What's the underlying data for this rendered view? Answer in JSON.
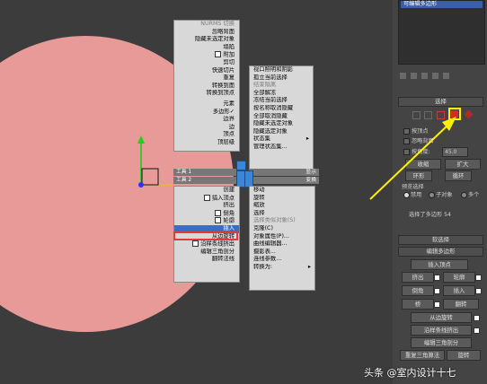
{
  "quad_menu": {
    "left_top": [
      {
        "label": "NURMS 切换",
        "dim": true
      },
      {
        "label": "忽略背面",
        "dim": false
      },
      {
        "label": "隐藏未选定对象",
        "dim": false
      },
      {
        "label": "塌陷",
        "dim": false
      },
      {
        "label": "附加",
        "dim": false,
        "checkbox": true
      },
      {
        "label": "剪切",
        "dim": false
      },
      {
        "label": "快速切片",
        "dim": false
      },
      {
        "label": "重复",
        "dim": false
      },
      {
        "label": "转换到面",
        "dim": false
      },
      {
        "label": "转换到顶点",
        "dim": false
      }
    ],
    "left_mid": [
      {
        "label": "元素",
        "dim": false
      },
      {
        "label": "多边形",
        "dim": false,
        "check": "✓"
      },
      {
        "label": "边界",
        "dim": false
      },
      {
        "label": "边",
        "dim": false
      },
      {
        "label": "顶点",
        "dim": false
      },
      {
        "label": "顶层级",
        "dim": false
      }
    ],
    "left_titles": [
      "工具 1",
      "工具 2"
    ],
    "right_titles": [
      "显示",
      "变换"
    ],
    "right_top": [
      {
        "label": "孤立当前选择",
        "dim": false
      },
      {
        "label": "结束隔离",
        "dim": true
      },
      {
        "label": "全部解冻",
        "dim": false
      },
      {
        "label": "冻结当前选择",
        "dim": false
      },
      {
        "label": "按名称取消隐藏",
        "dim": false
      },
      {
        "label": "全部取消隐藏",
        "dim": false
      },
      {
        "label": "隐藏未选定对象",
        "dim": false
      },
      {
        "label": "隐藏选定对象",
        "dim": false
      },
      {
        "label": "状态集",
        "dim": false,
        "arrow": true
      },
      {
        "label": "管理状态集...",
        "dim": false
      }
    ],
    "right_top_first": "视口照明和阴影",
    "left_bottom": [
      {
        "label": "创建",
        "dim": false
      },
      {
        "label": "插入顶点",
        "dim": false,
        "checkbox": true
      },
      {
        "label": "挤出",
        "dim": false
      },
      {
        "label": "倒角",
        "dim": false,
        "checkbox": true
      },
      {
        "label": "轮廓",
        "dim": false,
        "checkbox": true
      },
      {
        "label": "插入",
        "dim": false,
        "selected": true
      },
      {
        "label": "从边旋转",
        "dim": false
      },
      {
        "label": "沿样条线挤出",
        "dim": false,
        "checkbox": true
      },
      {
        "label": "编辑三角剖分",
        "dim": false
      },
      {
        "label": "翻转法线",
        "dim": false
      }
    ],
    "right_bottom": [
      {
        "label": "移动",
        "dim": false
      },
      {
        "label": "旋转",
        "dim": false
      },
      {
        "label": "缩放",
        "dim": false
      },
      {
        "label": "选择",
        "dim": false
      },
      {
        "label": "选择类似对象(S)",
        "dim": true
      },
      {
        "label": "克隆(C)",
        "dim": false
      },
      {
        "label": "对象属性(P)...",
        "dim": false
      },
      {
        "label": "曲线编辑器...",
        "dim": false
      },
      {
        "label": "摄影表...",
        "dim": false
      },
      {
        "label": "连线参数...",
        "dim": false
      },
      {
        "label": "转换为:",
        "dim": false,
        "arrow": true
      }
    ]
  },
  "panel": {
    "modifier_item": "可编辑多边形",
    "selection_header": "选择",
    "by_vertex": "按顶点",
    "ignore_backface": "忽略背面",
    "by_angle": "按角度:",
    "angle_value": "45.0",
    "shrink": "收缩",
    "grow": "扩大",
    "ring": "环形",
    "loop": "循环",
    "preview_selection": "预览选择",
    "disabled": "禁用",
    "subobject": "子对象",
    "multi": "多个",
    "selected_count": "选择了多边形 54",
    "soft_selection_header": "软选择",
    "edit_polygons_header": "编辑多边形",
    "insert_vertex": "插入顶点",
    "extrude": "挤出",
    "outline": "轮廓",
    "bevel": "倒角",
    "inset": "插入",
    "bridge": "桥",
    "flip": "翻转",
    "hinge": "从边旋转",
    "extrude_spline": "沿样条线挤出",
    "edit_tri": "编辑三角剖分",
    "retriangulate": "重复三角算法",
    "turn": "旋转"
  },
  "watermark": "头条 @室内设计十七",
  "colors": {
    "highlight_yellow": "#ffef00",
    "menu_selected": "#3470c8",
    "menu_callout_red": "#e23a3a",
    "disc": "#e89a98"
  }
}
